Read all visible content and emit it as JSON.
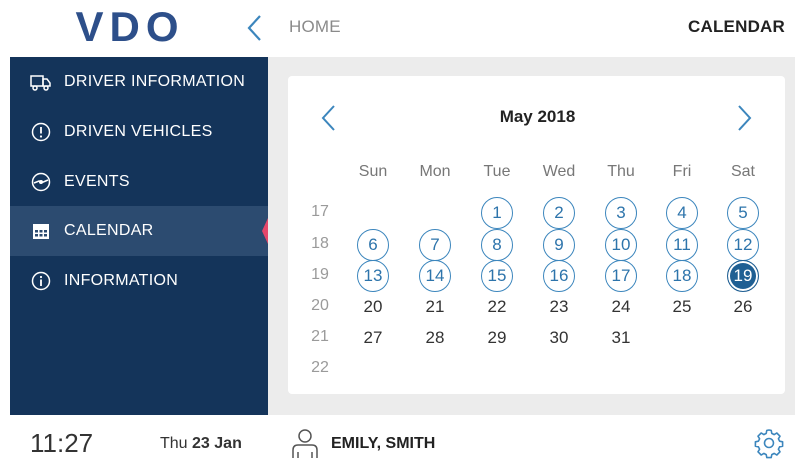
{
  "brand": {
    "logo_text": "VDO",
    "color": "#2d4f8a"
  },
  "header": {
    "breadcrumb": "HOME",
    "title": "CALENDAR",
    "back_icon": "chevron-left-icon"
  },
  "sidebar": {
    "items": [
      {
        "label": "DRIVER INFORMATION",
        "icon": "truck-icon",
        "active": false
      },
      {
        "label": "DRIVEN VEHICLES",
        "icon": "alert-circle-icon",
        "active": false
      },
      {
        "label": "EVENTS",
        "icon": "target-icon",
        "active": false
      },
      {
        "label": "CALENDAR",
        "icon": "calendar-icon",
        "active": true
      },
      {
        "label": "INFORMATION",
        "icon": "info-icon",
        "active": false
      }
    ]
  },
  "calendar": {
    "month_label": "May 2018",
    "prev_icon": "chevron-left-icon",
    "next_icon": "chevron-right-icon",
    "weekdays": [
      "Sun",
      "Mon",
      "Tue",
      "Wed",
      "Thu",
      "Fri",
      "Sat"
    ],
    "weeks": [
      {
        "week": "17",
        "days": [
          "",
          "",
          "1",
          "2",
          "3",
          "4",
          "5"
        ]
      },
      {
        "week": "18",
        "days": [
          "6",
          "7",
          "8",
          "9",
          "10",
          "11",
          "12"
        ]
      },
      {
        "week": "19",
        "days": [
          "13",
          "14",
          "15",
          "16",
          "17",
          "18",
          "19"
        ]
      },
      {
        "week": "20",
        "days": [
          "20",
          "21",
          "22",
          "23",
          "24",
          "25",
          "26"
        ]
      },
      {
        "week": "21",
        "days": [
          "27",
          "28",
          "29",
          "30",
          "31",
          "",
          ""
        ]
      },
      {
        "week": "22",
        "days": [
          "",
          "",
          "",
          "",
          "",
          "",
          ""
        ]
      }
    ],
    "marked_days": [
      "1",
      "2",
      "3",
      "4",
      "5",
      "6",
      "7",
      "8",
      "9",
      "10",
      "11",
      "12",
      "13",
      "14",
      "15",
      "16",
      "17",
      "18"
    ],
    "selected_day": "19",
    "accent_color": "#3c86bd"
  },
  "footer": {
    "time": "11:27",
    "day_name": "Thu",
    "date": "23 Jan",
    "user_name": "EMILY, SMITH",
    "user_icon": "driver-icon",
    "settings_icon": "gear-icon"
  }
}
